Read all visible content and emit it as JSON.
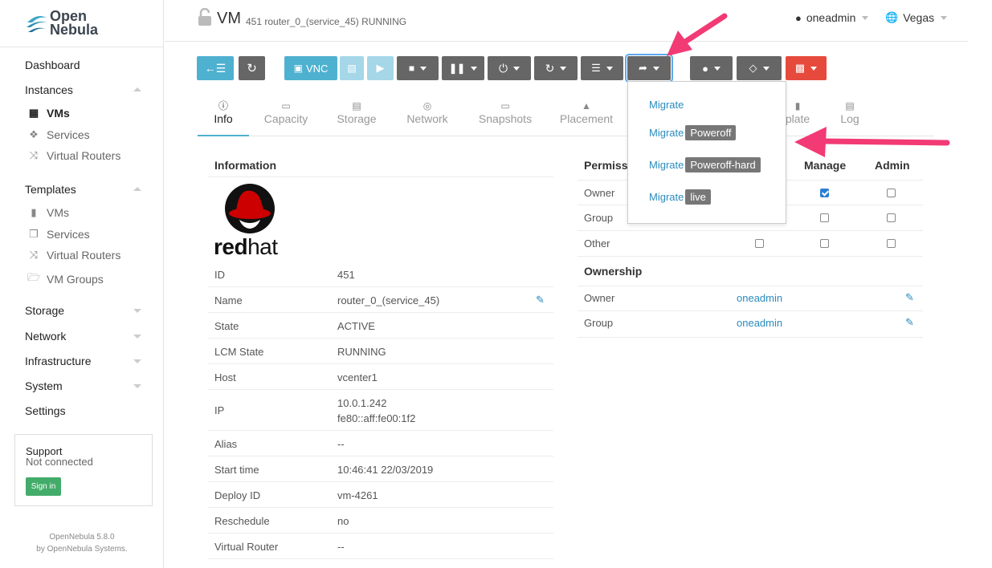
{
  "sidebar": {
    "logo_line1": "Open",
    "logo_line2": "Nebula",
    "dashboard": "Dashboard",
    "instances": "Instances",
    "instances_items": [
      "VMs",
      "Services",
      "Virtual Routers"
    ],
    "templates": "Templates",
    "templates_items": [
      "VMs",
      "Services",
      "Virtual Routers",
      "VM Groups"
    ],
    "storage": "Storage",
    "network": "Network",
    "infrastructure": "Infrastructure",
    "system": "System",
    "settings": "Settings",
    "support_title": "Support",
    "support_status": "Not connected",
    "signin": "Sign in",
    "version": "OpenNebula 5.8.0",
    "by": "by OpenNebula Systems."
  },
  "header": {
    "title": "VM",
    "subtitle": "451 router_0_(service_45) RUNNING",
    "user": "oneadmin",
    "zone": "Vegas"
  },
  "toolbar": {
    "vnc": "VNC"
  },
  "tabs": [
    "Info",
    "Capacity",
    "Storage",
    "Network",
    "Snapshots",
    "Placement",
    "Template",
    "Log"
  ],
  "tabs_visible": [
    "Info",
    "Capacity",
    "Storage",
    "Network",
    "Snapshots",
    "Placement",
    "plate",
    "Log"
  ],
  "information": {
    "title": "Information",
    "logo_text_bold": "red",
    "logo_text_light": "hat",
    "rows": [
      {
        "k": "ID",
        "v": "451"
      },
      {
        "k": "Name",
        "v": "router_0_(service_45)"
      },
      {
        "k": "State",
        "v": "ACTIVE"
      },
      {
        "k": "LCM State",
        "v": "RUNNING"
      },
      {
        "k": "Host",
        "v": "vcenter1"
      },
      {
        "k": "IP",
        "v": "10.0.1.242",
        "v2": "fe80::aff:fe00:1f2"
      },
      {
        "k": "Alias",
        "v": "--"
      },
      {
        "k": "Start time",
        "v": "10:46:41 22/03/2019"
      },
      {
        "k": "Deploy ID",
        "v": "vm-4261"
      },
      {
        "k": "Reschedule",
        "v": "no"
      },
      {
        "k": "Virtual Router",
        "v": "--"
      }
    ]
  },
  "permissions": {
    "title": "Permissi",
    "manage": "Manage",
    "admin": "Admin",
    "rows": [
      "Owner",
      "Group",
      "Other"
    ],
    "checks": {
      "owner_manage": true
    }
  },
  "ownership": {
    "title": "Ownership",
    "owner_label": "Owner",
    "owner": "oneadmin",
    "group_label": "Group",
    "group": "oneadmin"
  },
  "dropdown": {
    "items": [
      {
        "label": "Migrate",
        "badge": ""
      },
      {
        "label": "Migrate",
        "badge": "Poweroff"
      },
      {
        "label": "Migrate",
        "badge": "Poweroff-hard"
      },
      {
        "label": "Migrate",
        "badge": "live"
      }
    ]
  },
  "colors": {
    "accent": "#4fb1d0",
    "danger": "#e64a3c",
    "arrow": "#f23a74",
    "link": "#2a8bbd"
  }
}
